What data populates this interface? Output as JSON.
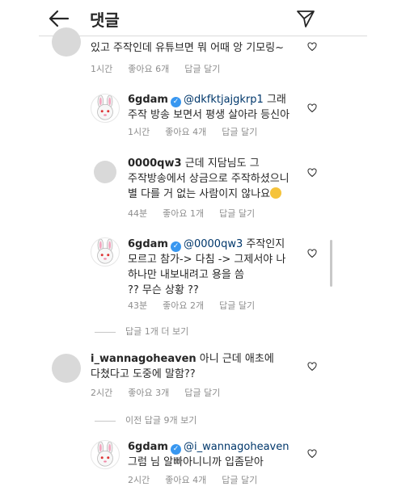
{
  "header": {
    "title": "댓글"
  },
  "comments": [
    {
      "id": "c0",
      "text": "있고 주작인데 유튜브면 뭐 어때 앙 기모링~",
      "time": "1시간",
      "likes": "좋아요 6개",
      "reply": "답글 달기"
    },
    {
      "id": "c1",
      "username": "6gdam",
      "mention": "@dkfktjajgkrp1",
      "line1_rest": "그래",
      "line2": "주작 방송 보면서 평생 살아라 등신아",
      "time": "1시간",
      "likes": "좋아요 4개",
      "reply": "답글 달기"
    },
    {
      "id": "c2",
      "username": "0000qw3",
      "line1_rest": "근데 지담님도 그",
      "line2": "주작방송에서 상금으로 주작하셨으니",
      "line3": "별 다를 거 없는 사람이지 않나요",
      "time": "44분",
      "likes": "좋아요 1개",
      "reply": "답글 달기"
    },
    {
      "id": "c3",
      "username": "6gdam",
      "mention": "@0000qw3",
      "line1_rest": "주작인지",
      "line2": "모르고 참가-> 다침 -> 그제서야 나",
      "line3": "하나만 내보내려고 용을 씀",
      "line4": "?? 무슨 상황 ??",
      "time": "43분",
      "likes": "좋아요 2개",
      "reply": "답글 달기"
    },
    {
      "id": "c4",
      "username": "i_wannagoheaven",
      "line1_rest": "아니 근데 애초에",
      "line2": "다쳤다고 도중에 말함??",
      "time": "2시간",
      "likes": "좋아요 3개",
      "reply": "답글 달기"
    },
    {
      "id": "c5",
      "username": "6gdam",
      "mention": "@i_wannagoheaven",
      "line2": "그럼 님 알빠아니니까 입좀닫아",
      "time": "2시간",
      "likes": "좋아요 4개",
      "reply": "답글 달기"
    }
  ],
  "view_replies_1": "답글 1개 더 보기",
  "view_replies_2": "이전 답글 9개 보기",
  "colors": {
    "mention": "#00376b",
    "meta": "#8e8e8e",
    "verified": "#3897f0"
  }
}
